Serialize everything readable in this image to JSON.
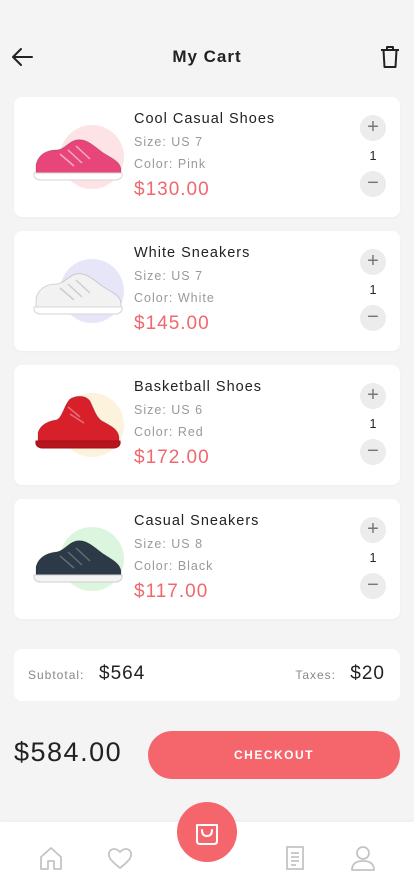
{
  "header": {
    "title": "My Cart",
    "back_icon": "arrow-left-icon",
    "trash_icon": "trash-icon"
  },
  "colors": {
    "accent": "#f5666c",
    "price": "#f0686e",
    "background": "#f4f4f4"
  },
  "cart_items": [
    {
      "name": "Cool Casual Shoes",
      "size": "Size: US 7",
      "color": "Color: Pink",
      "price": "$130.00",
      "qty": "1",
      "shoe_color": "#e8467a",
      "circle_color": "#fde3e5"
    },
    {
      "name": "White Sneakers",
      "size": "Size: US 7",
      "color": "Color: White",
      "price": "$145.00",
      "qty": "1",
      "shoe_color": "#f2f2f2",
      "circle_color": "#e6e6f8"
    },
    {
      "name": "Basketball Shoes",
      "size": "Size: US 6",
      "color": "Color: Red",
      "price": "$172.00",
      "qty": "1",
      "shoe_color": "#d8202b",
      "circle_color": "#fdf3dc"
    },
    {
      "name": "Casual Sneakers",
      "size": "Size: US 8",
      "color": "Color: Black",
      "price": "$117.00",
      "qty": "1",
      "shoe_color": "#2c3a47",
      "circle_color": "#dcf5de"
    }
  ],
  "summary": {
    "subtotal_label": "Subtotal:",
    "subtotal_value": "$564",
    "taxes_label": "Taxes:",
    "taxes_value": "$20"
  },
  "total": "$584.00",
  "checkout_label": "CHECKOUT",
  "tabbar": {
    "icons": [
      "home-icon",
      "heart-icon",
      "cart-icon",
      "orders-icon",
      "profile-icon"
    ]
  }
}
